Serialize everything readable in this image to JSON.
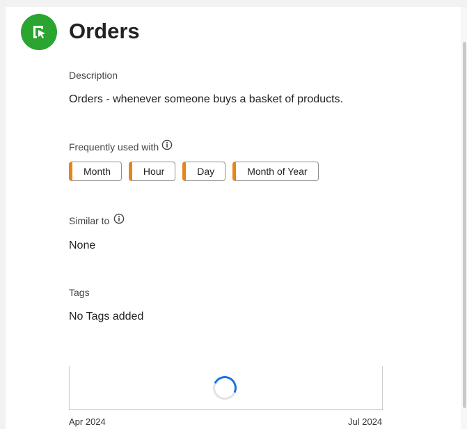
{
  "header": {
    "title": "Orders",
    "icon": "segment-arrow-icon",
    "icon_color": "#2aa52f"
  },
  "description": {
    "label": "Description",
    "text": "Orders - whenever someone buys a basket of products."
  },
  "frequently_used": {
    "label": "Frequently used with",
    "chips": [
      "Month",
      "Hour",
      "Day",
      "Month of Year"
    ],
    "chip_accent": "#e68619"
  },
  "similar": {
    "label": "Similar to",
    "value": "None"
  },
  "tags": {
    "label": "Tags",
    "value": "No Tags added"
  },
  "chart": {
    "status": "loading",
    "x_start_label": "Apr 2024",
    "x_end_label": "Jul 2024",
    "spinner_color": "#1473e6"
  }
}
